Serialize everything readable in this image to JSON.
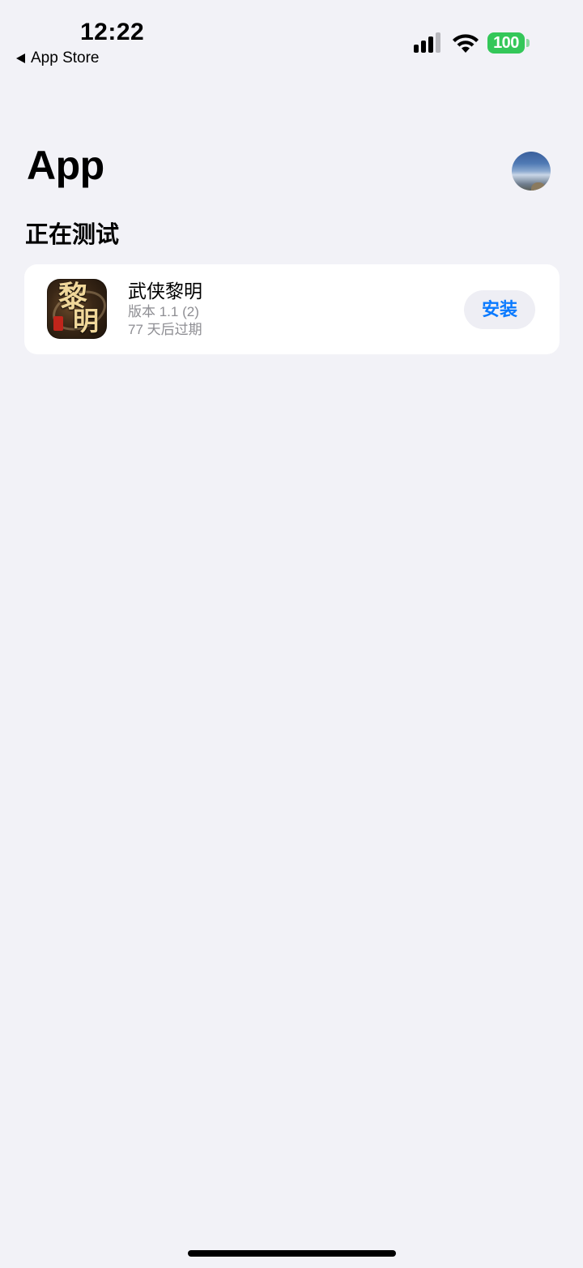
{
  "status_bar": {
    "time": "12:22",
    "back_label": "App Store",
    "battery_level": "100",
    "icons": [
      "back-arrow-icon",
      "cellular-signal-icon",
      "wifi-icon",
      "battery-icon"
    ],
    "battery_color": "#34c759"
  },
  "header": {
    "title": "App",
    "avatar_icon": "profile-avatar"
  },
  "section": {
    "title": "正在测试"
  },
  "apps": [
    {
      "name": "武侠黎明",
      "version": "版本 1.1 (2)",
      "expiry": "77 天后过期",
      "install_label": "安装",
      "icon_text": "黎明"
    }
  ],
  "colors": {
    "background": "#f2f2f7",
    "card": "#ffffff",
    "accent": "#0a7aff",
    "secondary_text": "#8e8e93"
  }
}
